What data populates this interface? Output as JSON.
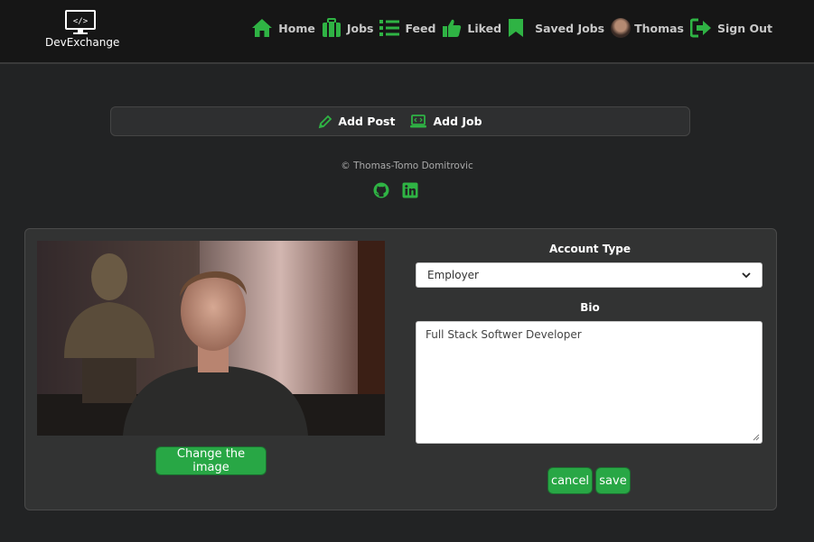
{
  "brand": {
    "name": "DevExchange",
    "icon": "monitor-code-icon"
  },
  "nav": {
    "items": [
      {
        "label": "Home",
        "icon": "home-icon"
      },
      {
        "label": "Jobs",
        "icon": "briefcase-icon"
      },
      {
        "label": "Feed",
        "icon": "list-icon"
      },
      {
        "label": "Liked",
        "icon": "thumbs-up-icon"
      },
      {
        "label": "Saved Jobs",
        "icon": "bookmark-icon"
      },
      {
        "label": "Thomas",
        "icon": "avatar"
      },
      {
        "label": "Sign Out",
        "icon": "sign-out-icon"
      }
    ]
  },
  "actions": {
    "add_post": "Add Post",
    "add_job": "Add Job"
  },
  "footer": {
    "copyright": "© Thomas-Tomo Domitrovic",
    "social": [
      "github-icon",
      "linkedin-icon"
    ]
  },
  "profile": {
    "change_image": "Change the image",
    "account_type_label": "Account Type",
    "account_type_value": "Employer",
    "bio_label": "Bio",
    "bio_value": "Full Stack Softwer Developer",
    "cancel": "cancel",
    "save": "save"
  },
  "colors": {
    "accent": "#28a745",
    "icon_green": "#2fb344",
    "navbar": "#161616",
    "background": "#222324",
    "card": "#323333"
  }
}
